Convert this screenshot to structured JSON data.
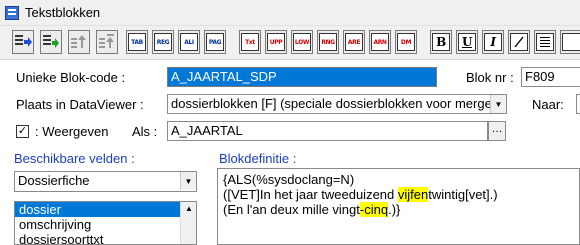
{
  "window": {
    "title": "Tekstblokken"
  },
  "toolbar": {
    "tags": [
      "TAB",
      "REG",
      "ALI",
      "PAG",
      "Txt",
      "UPP",
      "LOW",
      "RNG",
      "ARE",
      "ARN",
      "DM"
    ],
    "format": {
      "bold": "B",
      "underline": "U",
      "italic": "I"
    }
  },
  "form": {
    "code_label": "Unieke Blok-code :",
    "code_value": "A_JAARTAL_SDP",
    "nr_label": "Blok nr :",
    "nr_value": "F809",
    "plaats_label": "Plaats in DataViewer :",
    "plaats_value": "dossierblokken [F] (speciale dossierblokken voor merge",
    "naar_label": "Naar:",
    "weergeven_checked": true,
    "weergeven_label": ": Weergeven",
    "als_label": "Als :",
    "als_value": "A_JAARTAL"
  },
  "fields_panel": {
    "label": "Beschikbare velden :",
    "combo_value": "Dossierfiche",
    "items": [
      "dossier",
      "omschrijving",
      "dossiersoorttxt"
    ],
    "selected_index": 0
  },
  "definition": {
    "label": "Blokdefinitie :",
    "line1": "{ALS(%sysdoclang=N)",
    "line2_a": "([VET]In het jaar tweeduizend ",
    "line2_hl": "vijfen",
    "line2_b": "twintig[vet].)",
    "line3_a": "(En l'an deux mille vingt",
    "line3_hl": "-cinq",
    "line3_b": ".)}"
  }
}
